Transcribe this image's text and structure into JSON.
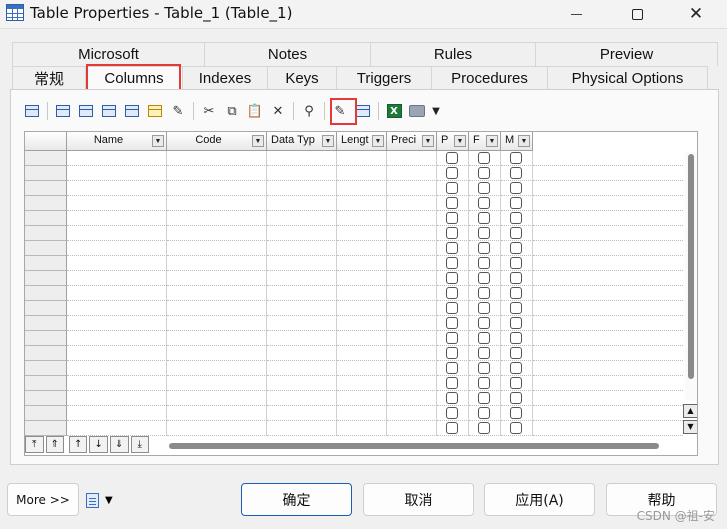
{
  "window": {
    "title": "Table Properties - Table_1 (Table_1)",
    "minimize_icon": "minimize-icon",
    "maximize_icon": "maximize-icon",
    "close_icon": "close-icon"
  },
  "tabs": {
    "back_row": [
      "Microsoft",
      "Notes",
      "Rules",
      "Preview"
    ],
    "front_row": [
      "常规",
      "Columns",
      "Indexes",
      "Keys",
      "Triggers",
      "Procedures",
      "Physical Options"
    ],
    "active": "Columns"
  },
  "toolbar": {
    "icons": [
      "properties-icon",
      "insert-row-icon",
      "add-row-icon",
      "add-columns-icon",
      "replace-domain-icon",
      "attribute-icon",
      "clear-icon",
      "cut-icon",
      "copy-icon",
      "paste-icon",
      "delete-icon",
      "find-icon",
      "customize-columns-filter-icon",
      "customize-columns-icon",
      "export-excel-icon",
      "print-icon",
      "dropdown-arrow-icon"
    ],
    "excel_letter": "X"
  },
  "grid": {
    "columns": [
      {
        "label": "Name"
      },
      {
        "label": "Code"
      },
      {
        "label": "Data Typ"
      },
      {
        "label": "Lengt"
      },
      {
        "label": "Preci"
      },
      {
        "label": "P"
      },
      {
        "label": "F"
      },
      {
        "label": "M"
      }
    ],
    "row_count": 19
  },
  "buttons": {
    "more": "More >>",
    "ok": "确定",
    "cancel": "取消",
    "apply": "应用(A)",
    "help": "帮助"
  },
  "watermark": "CSDN @祖-安",
  "colors": {
    "highlight": "#e53935",
    "primary_border": "#1a5fb4"
  }
}
